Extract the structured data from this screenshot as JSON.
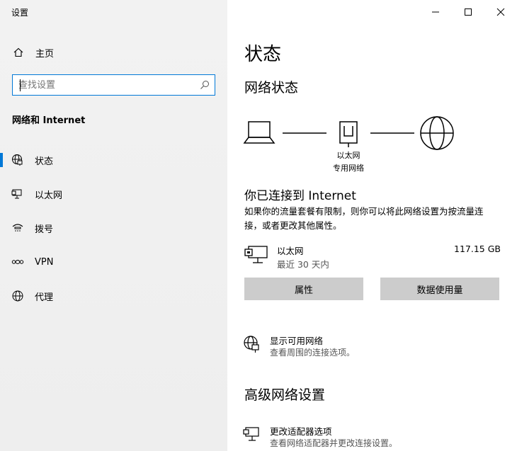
{
  "window": {
    "title": "设置"
  },
  "sidebar": {
    "home_label": "主页",
    "search": {
      "placeholder": "查找设置",
      "value": ""
    },
    "section_heading": "网络和 Internet",
    "items": [
      {
        "label": "状态",
        "icon": "globe-network-icon",
        "active": true
      },
      {
        "label": "以太网",
        "icon": "ethernet-icon",
        "active": false
      },
      {
        "label": "拨号",
        "icon": "dialup-icon",
        "active": false
      },
      {
        "label": "VPN",
        "icon": "vpn-icon",
        "active": false
      },
      {
        "label": "代理",
        "icon": "globe-icon",
        "active": false
      }
    ]
  },
  "main": {
    "title": "状态",
    "network_status_title": "网络状态",
    "diagram": {
      "adapter_label": "以太网",
      "network_label": "专用网络"
    },
    "connected_title": "你已连接到 Internet",
    "connected_desc": "如果你的流量套餐有限制，则你可以将此网络设置为按流量连接，或者更改其他属性。",
    "connection": {
      "name": "以太网",
      "period": "最近 30 天内",
      "usage": "117.15 GB"
    },
    "buttons": {
      "properties": "属性",
      "data_usage": "数据使用量"
    },
    "show_networks": {
      "title": "显示可用网络",
      "subtitle": "查看周围的连接选项。"
    },
    "advanced_title": "高级网络设置",
    "adapter_options": {
      "title": "更改适配器选项",
      "subtitle": "查看网络适配器并更改连接设置。"
    }
  },
  "colors": {
    "accent": "#0078d7",
    "sidebar_bg": "#f0f0f0",
    "button_bg": "#cccccc"
  }
}
